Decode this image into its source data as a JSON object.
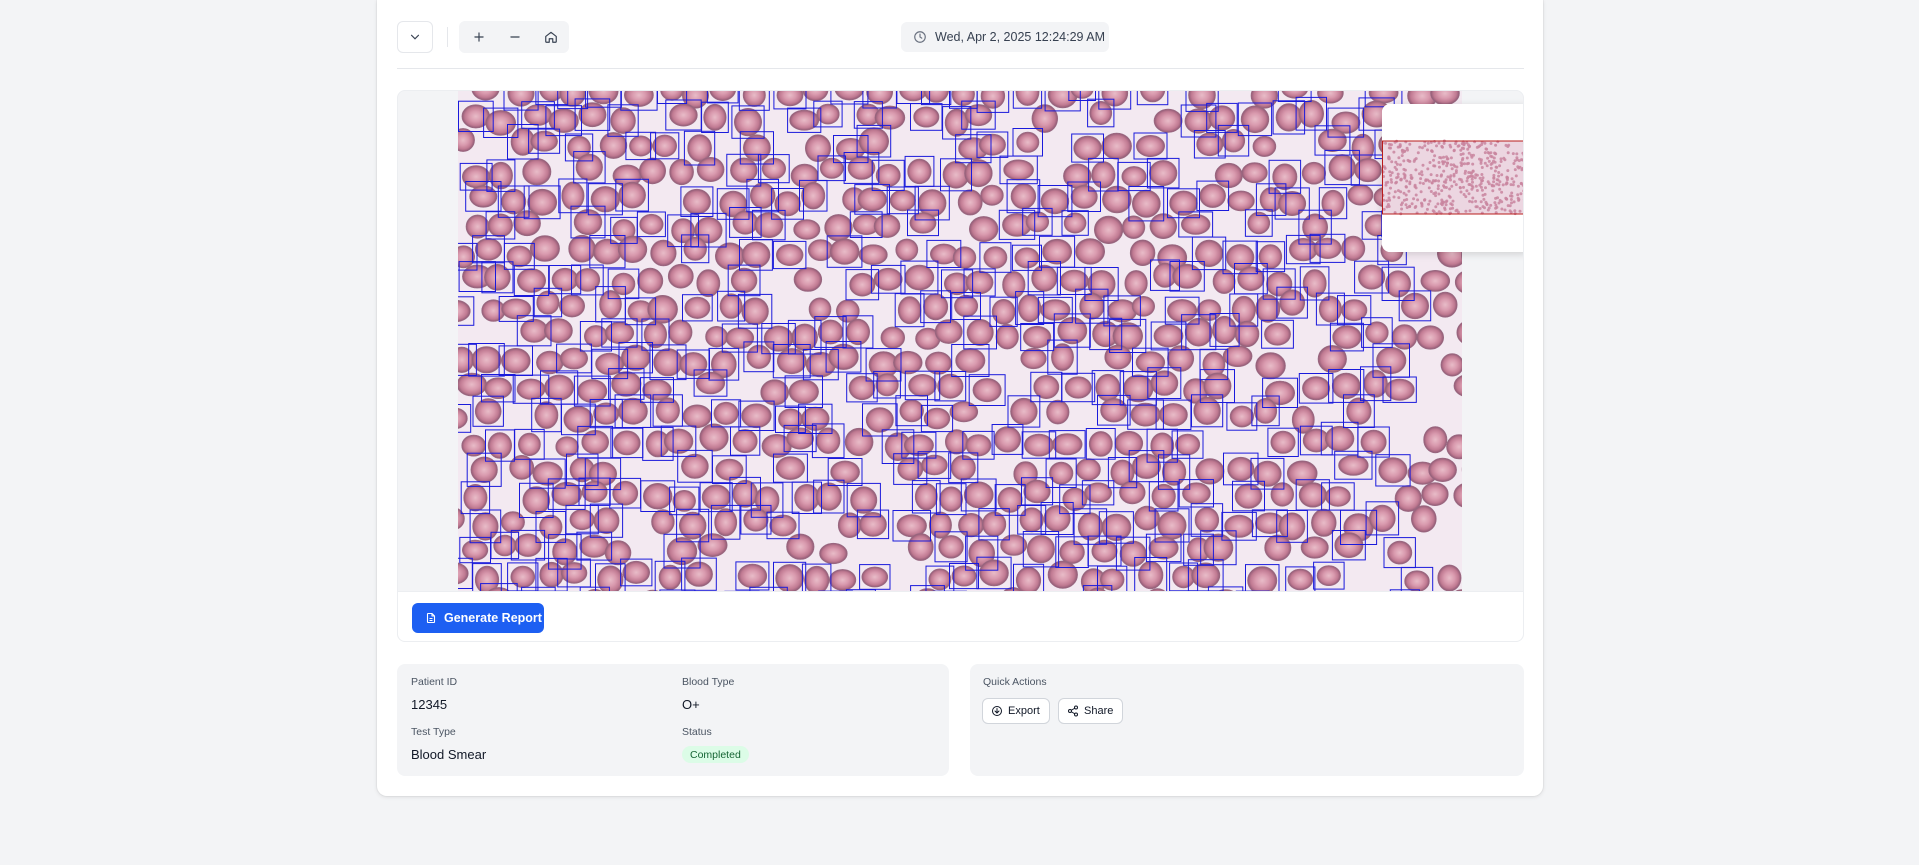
{
  "toolbar": {
    "collapse_icon": "chevron-down-icon",
    "zoom_in_icon": "plus-icon",
    "zoom_out_icon": "minus-icon",
    "home_icon": "home-icon",
    "datetime_icon": "clock-icon",
    "datetime": "Wed, Apr 2, 2025 12:24:29 AM"
  },
  "viewer": {
    "image_content": "blood-smear-with-cell-detection-boxes",
    "detection_box_color": "#1a1adb",
    "minimap_viewport_color": "#b91c1c"
  },
  "report": {
    "button_label": "Generate Report",
    "button_icon": "file-text-icon",
    "accent": "#1d5ff2"
  },
  "patient": {
    "id_label": "Patient ID",
    "id_value": "12345",
    "blood_type_label": "Blood Type",
    "blood_type_value": "O+",
    "test_type_label": "Test Type",
    "test_type_value": "Blood Smear",
    "status_label": "Status",
    "status_value": "Completed",
    "status_color": "#166534"
  },
  "quick_actions": {
    "title": "Quick Actions",
    "export_label": "Export",
    "export_icon": "download-icon",
    "share_label": "Share",
    "share_icon": "share-icon"
  }
}
